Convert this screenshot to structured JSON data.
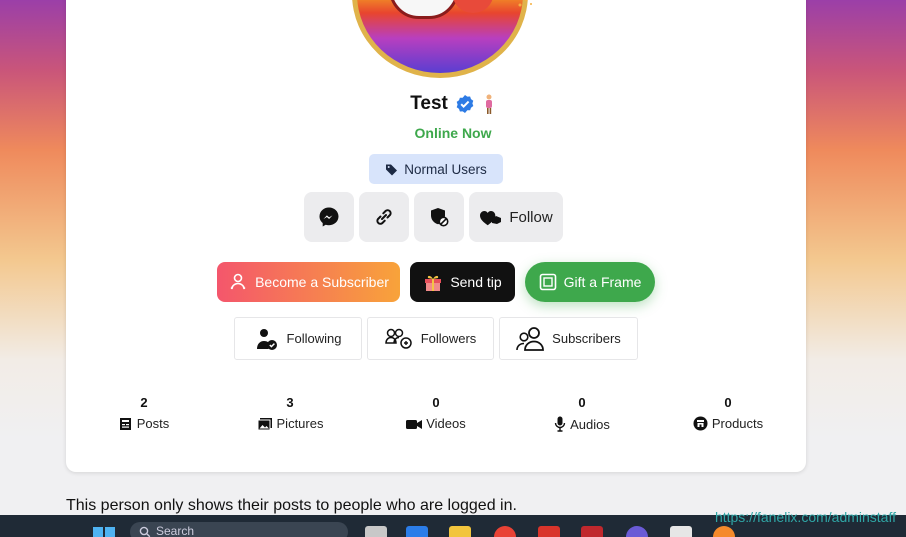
{
  "profile": {
    "name": "Test",
    "status": "Online Now",
    "role_badge": "Normal Users"
  },
  "actions": {
    "follow_label": "Follow"
  },
  "primary_buttons": {
    "subscribe": "Become a Subscriber",
    "tip": "Send tip",
    "gift": "Gift a Frame"
  },
  "tabs": {
    "following": "Following",
    "followers": "Followers",
    "subscribers": "Subscribers"
  },
  "stats": [
    {
      "count": "2",
      "label": "Posts",
      "icon": "newspaper-icon"
    },
    {
      "count": "3",
      "label": "Pictures",
      "icon": "image-icon"
    },
    {
      "count": "0",
      "label": "Videos",
      "icon": "video-camera-icon"
    },
    {
      "count": "0",
      "label": "Audios",
      "icon": "microphone-icon"
    },
    {
      "count": "0",
      "label": "Products",
      "icon": "shop-icon"
    }
  ],
  "notice": "This person only shows their posts to people who are logged in.",
  "watermark": "https://fanelix.com/adminstaff",
  "taskbar": {
    "search_placeholder": "Search"
  },
  "colors": {
    "online": "#3ea84c",
    "badge_bg": "#d8e4fb",
    "gift_green": "#3ea84c",
    "subscribe_gradient_start": "#f4566c",
    "subscribe_gradient_end": "#f8a33a",
    "verified_blue": "#2d7be5"
  }
}
